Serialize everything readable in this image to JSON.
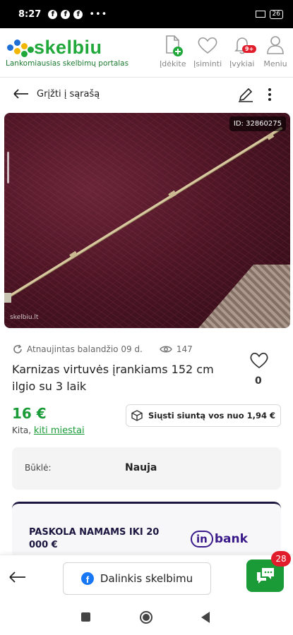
{
  "status_bar": {
    "time": "8:27",
    "dots": "•••",
    "battery": "26"
  },
  "header": {
    "brand": "skelbiu",
    "tagline": "Lankomiausias skelbimų portalas",
    "nav": [
      {
        "label": "Įdėkite",
        "icon": "add-document-icon"
      },
      {
        "label": "Įsiminti",
        "icon": "heart-icon"
      },
      {
        "label": "Įvykiai",
        "icon": "bell-icon",
        "badge": "9+"
      },
      {
        "label": "Meniu",
        "icon": "user-icon"
      }
    ]
  },
  "subnav": {
    "back_label": "Grįžti į sąrašą"
  },
  "listing": {
    "id_badge": "ID: 32860275",
    "watermark": "skelbiu.lt",
    "updated": "Atnaujintas balandžio 09 d.",
    "views": "147",
    "title": "Karnizas virtuvės įrankiams 152 cm ilgio su 3 laik",
    "favorites": "0",
    "price": "16 €",
    "location_prefix": "Kita,",
    "location_link": "kiti miestai",
    "shipping_label": "Siųsti siuntą vos nuo 1,94 €",
    "condition_label": "Būklė:",
    "condition_value": "Nauja"
  },
  "ad": {
    "text": "PASKOLA NAMAMS IKI 20 000 €",
    "logo_box": "in",
    "logo_text": "bank"
  },
  "bottom_bar": {
    "share_label": "Dalinkis skelbimu",
    "chat_badge": "28"
  },
  "colors": {
    "brand_green": "#20a83b",
    "price_green": "#1a9b37",
    "badge_red": "#e11d2c",
    "inbank_purple": "#3a1a8a"
  }
}
